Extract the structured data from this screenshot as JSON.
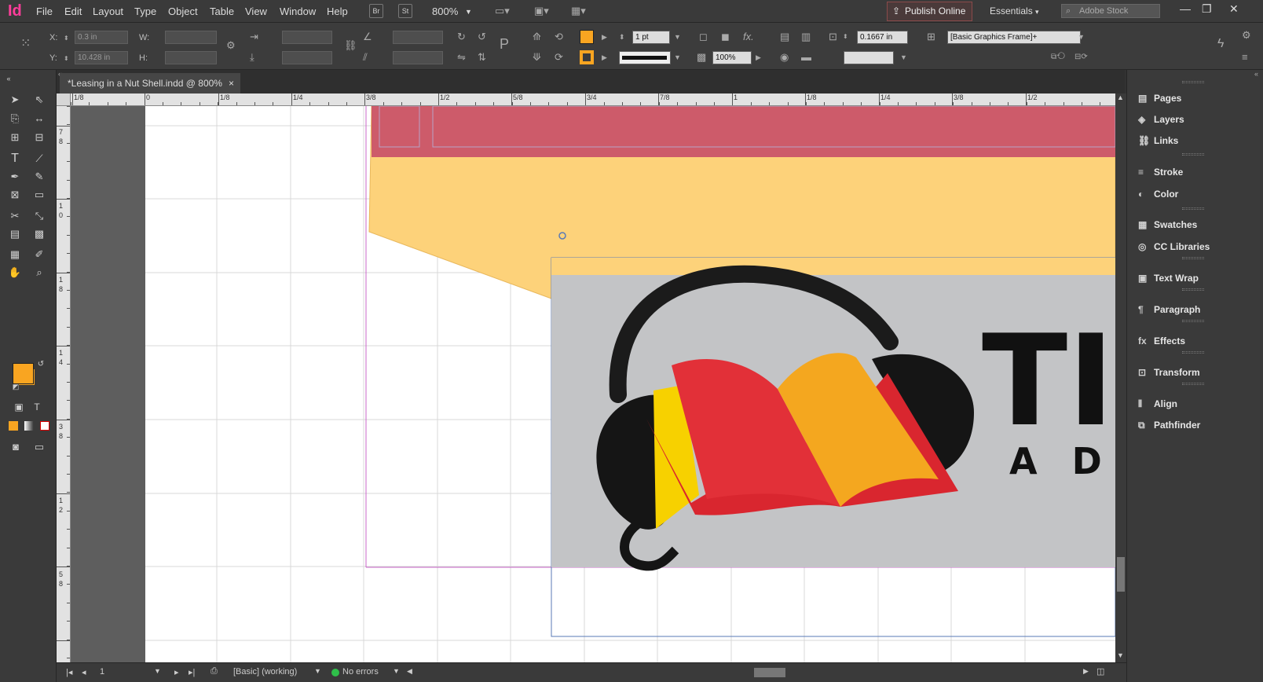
{
  "app": {
    "logo": "Id"
  },
  "menu": [
    "File",
    "Edit",
    "Layout",
    "Type",
    "Object",
    "Table",
    "View",
    "Window",
    "Help"
  ],
  "menubar": {
    "bridge_btn": "Br",
    "stock_btn": "St",
    "zoom": "800%",
    "publish": "Publish Online",
    "workspace": "Essentials",
    "search_placeholder": "Adobe Stock"
  },
  "control": {
    "x_label": "X:",
    "y_label": "Y:",
    "w_label": "W:",
    "h_label": "H:",
    "x_value": "0.3 in",
    "y_value": "10.428 in",
    "stroke_weight": "1 pt",
    "opacity": "100%",
    "fitting_offset": "0.1667 in",
    "object_style": "[Basic Graphics Frame]+"
  },
  "colors": {
    "fill": "#f9a521",
    "accent": "#ff3d9a",
    "band": "#cd5b6a",
    "yellow": "#fdd27a"
  },
  "document_tab": {
    "title": "*Leasing in a Nut Shell.indd @ 800%",
    "close": "×"
  },
  "ruler": {
    "h": [
      "1/8",
      "0",
      "1/8",
      "1/4",
      "3/8",
      "1/2",
      "5/8",
      "3/4",
      "7/8",
      "1",
      "1/8",
      "1/4",
      "3/8",
      "1/2"
    ],
    "v": [
      "7",
      "8",
      "1",
      "0",
      "1",
      "8",
      "1",
      "4",
      "3",
      "8",
      "1",
      "2",
      "5",
      "8"
    ]
  },
  "panels": [
    {
      "label": "Pages",
      "icon": "pages-icon"
    },
    {
      "label": "Layers",
      "icon": "layers-icon"
    },
    {
      "label": "Links",
      "icon": "links-icon"
    },
    {
      "label": "Stroke",
      "icon": "stroke-icon"
    },
    {
      "label": "Color",
      "icon": "color-icon"
    },
    {
      "label": "Swatches",
      "icon": "swatches-icon"
    },
    {
      "label": "CC Libraries",
      "icon": "cc-libraries-icon"
    },
    {
      "label": "Text Wrap",
      "icon": "text-wrap-icon"
    },
    {
      "label": "Paragraph",
      "icon": "paragraph-icon"
    },
    {
      "label": "Effects",
      "icon": "effects-icon"
    },
    {
      "label": "Transform",
      "icon": "transform-icon"
    },
    {
      "label": "Align",
      "icon": "align-icon"
    },
    {
      "label": "Pathfinder",
      "icon": "pathfinder-icon"
    }
  ],
  "logo_text": {
    "big": "TI",
    "sub": "A D"
  },
  "status": {
    "page": "1",
    "preflight_profile": "[Basic] (working)",
    "errors": "No errors"
  }
}
